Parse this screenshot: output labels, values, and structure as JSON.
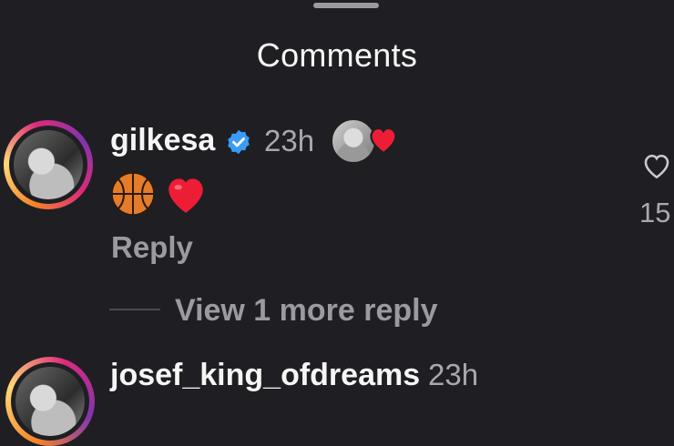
{
  "sheet": {
    "title": "Comments"
  },
  "comment": {
    "username": "gilkesa",
    "time": "23h",
    "emoji": [
      "basketball-emoji",
      "red-heart-emoji"
    ],
    "reply_label": "Reply",
    "like_count": "15",
    "view_more_label": "View 1 more reply"
  },
  "next_comment": {
    "username": "josef_king_ofdreams",
    "time": "23h"
  },
  "colors": {
    "background": "#1f1f23",
    "verified": "#3b9cf6",
    "heart": "#ee1d36",
    "muted_text": "#a8a8ae"
  }
}
